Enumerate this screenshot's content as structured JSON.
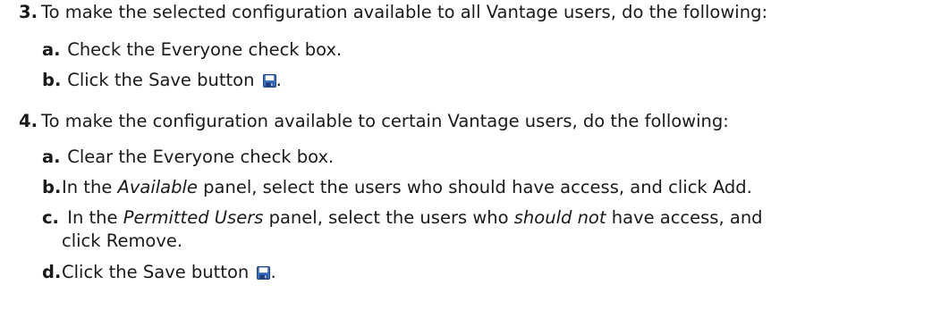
{
  "steps": [
    {
      "number": "3.",
      "text": "To make the selected configuration available to all Vantage users, do the following:",
      "substeps": [
        {
          "letter": "a.",
          "text": "Check the Everyone check box."
        },
        {
          "letter": "b.",
          "text_before": "Click the Save button",
          "text_after": ".",
          "icon": "save-icon"
        }
      ]
    },
    {
      "number": "4.",
      "text": "To make the configuration available to certain Vantage users, do the following:",
      "substeps": [
        {
          "letter": "a.",
          "text": "Clear the Everyone check box."
        },
        {
          "letter": "b.",
          "text_before": "In the",
          "emph": "Available",
          "text_after": "panel, select the users who should have access, and click Add."
        },
        {
          "letter": "c.",
          "text_before": "In the",
          "emph": "Permitted Users",
          "text_mid": "panel, select the users who",
          "emph2": "should not",
          "text_after": "have access, and",
          "continuation": "click Remove."
        },
        {
          "letter": "d.",
          "text_before": "Click the Save button",
          "text_after": ".",
          "icon": "save-icon"
        }
      ]
    }
  ],
  "colors": {
    "text": "#1a1a1a",
    "icon_blue": "#3a6fc4",
    "icon_dark": "#1f3f7a"
  }
}
